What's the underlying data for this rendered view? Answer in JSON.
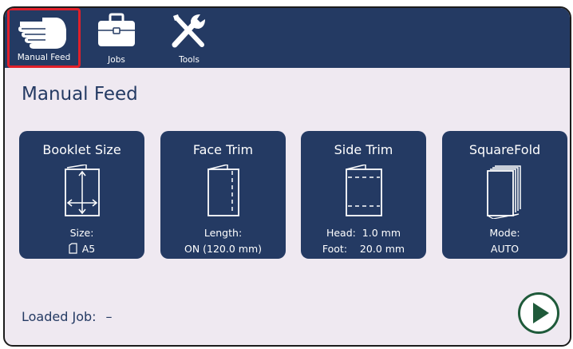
{
  "nav": {
    "tabs": [
      {
        "label": "Manual Feed",
        "icon": "hand-icon",
        "selected": true
      },
      {
        "label": "Jobs",
        "icon": "briefcase-icon",
        "selected": false
      },
      {
        "label": "Tools",
        "icon": "tools-icon",
        "selected": false
      }
    ]
  },
  "page": {
    "title": "Manual Feed"
  },
  "cards": [
    {
      "title": "Booklet Size",
      "icon": "booklet-size-icon",
      "line1": "Size:",
      "line2": "A5"
    },
    {
      "title": "Face Trim",
      "icon": "face-trim-icon",
      "line1": "Length:",
      "line2": "ON (120.0 mm)"
    },
    {
      "title": "Side Trim",
      "icon": "side-trim-icon",
      "line1": "Head:  1.0 mm",
      "line2": "Foot:    20.0 mm"
    },
    {
      "title": "SquareFold",
      "icon": "squarefold-icon",
      "line1": "Mode:",
      "line2": "AUTO"
    }
  ],
  "footer": {
    "loaded_job_label": "Loaded Job:",
    "loaded_job_value": "–"
  },
  "colors": {
    "nav_bg": "#243a63",
    "card_bg": "#243a63",
    "page_bg": "#efe9f1",
    "selected_outline": "#e0202a",
    "play_green": "#1f5a3a"
  }
}
